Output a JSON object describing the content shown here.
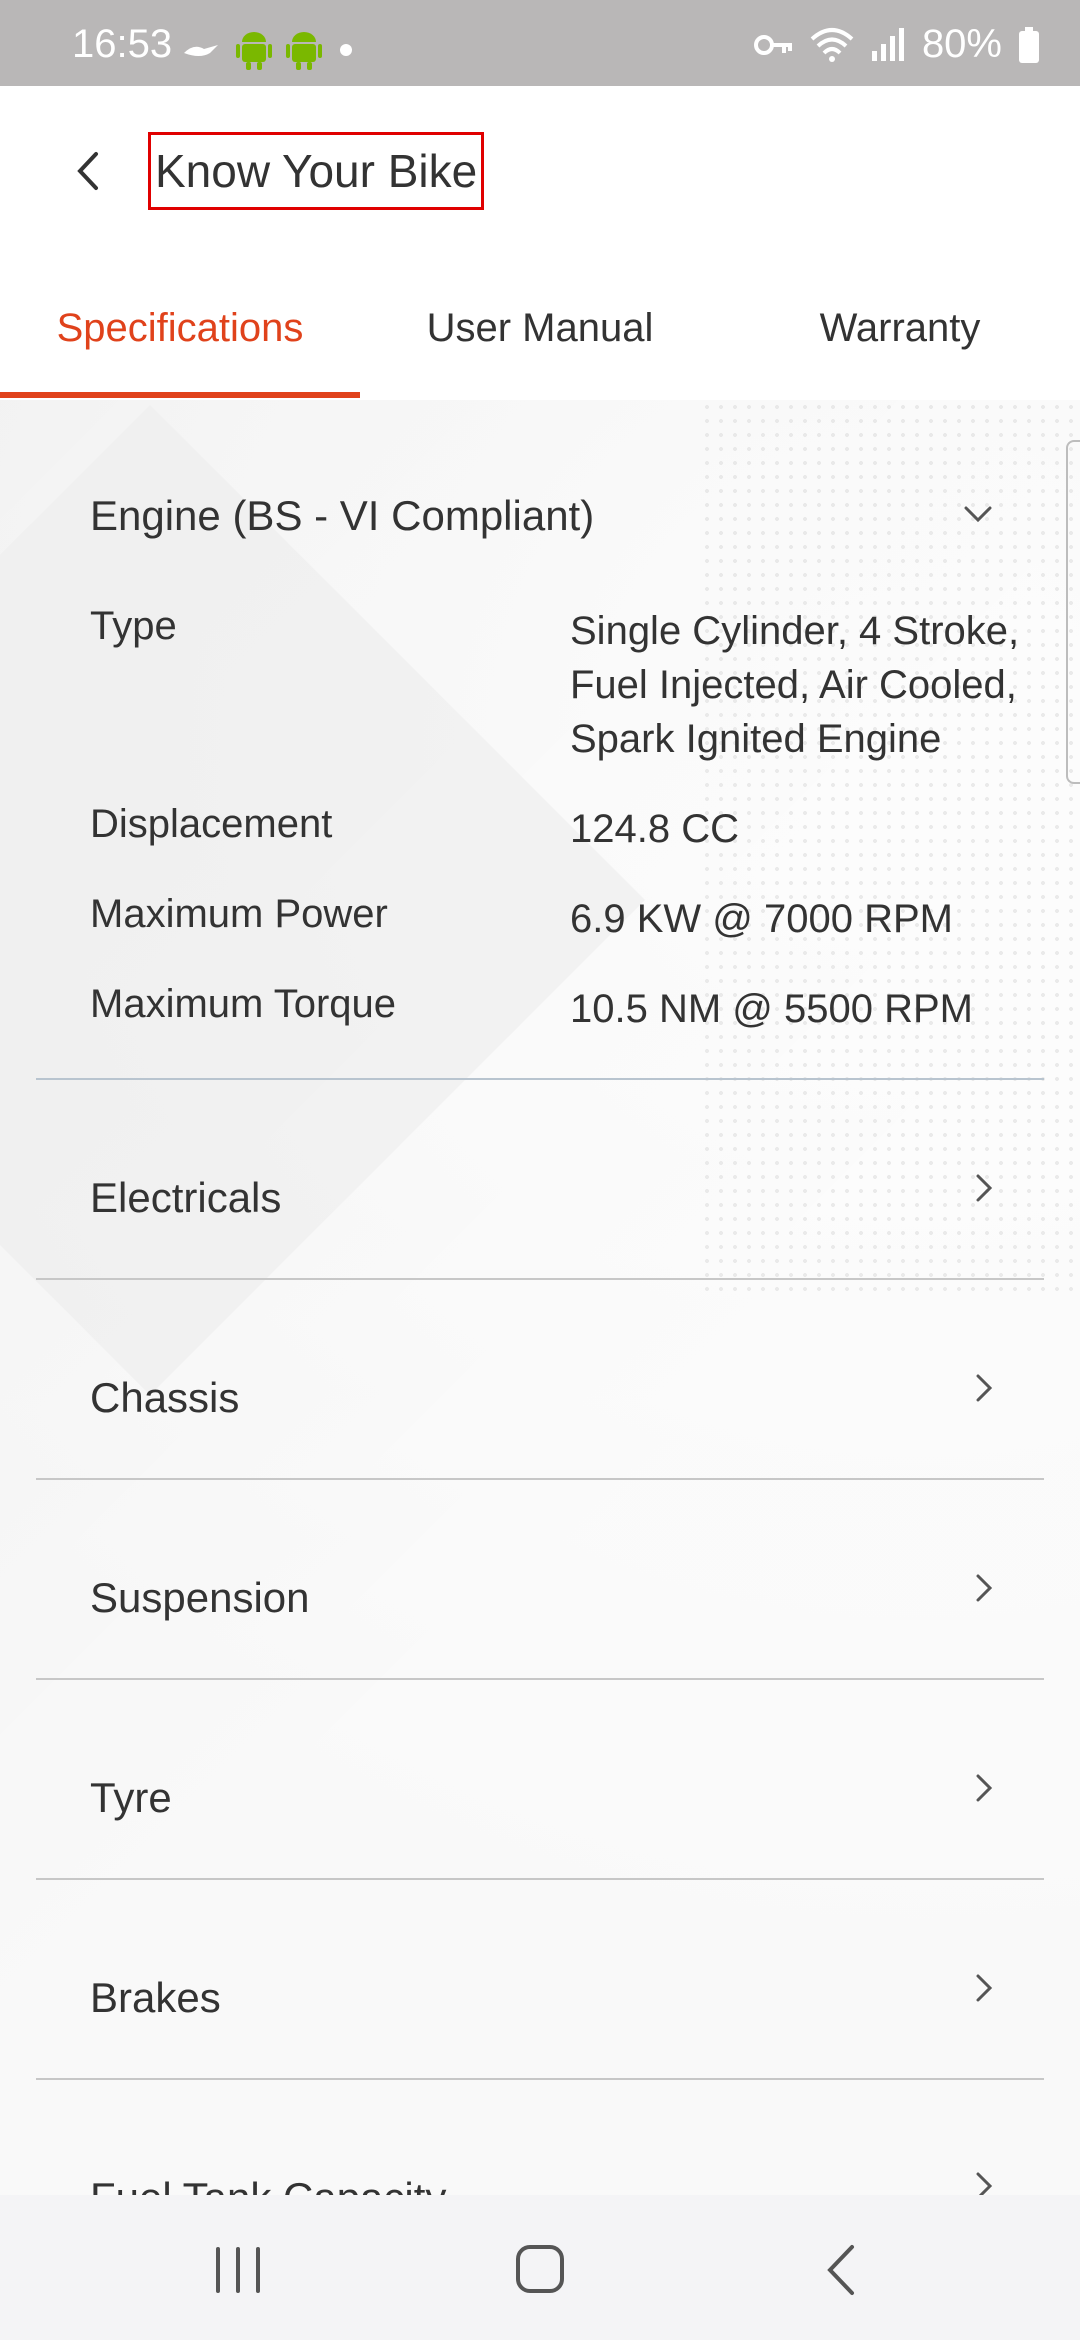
{
  "status_bar": {
    "time": "16:53",
    "battery": "80%",
    "icons": [
      "bird-icon",
      "android-icon",
      "android-icon",
      "dot-icon",
      "key-icon",
      "wifi-icon",
      "signal-icon",
      "battery-icon"
    ]
  },
  "header": {
    "title": "Know Your Bike",
    "back_icon": "chevron-left-icon"
  },
  "tabs": [
    {
      "label": "Specifications",
      "active": true
    },
    {
      "label": "User Manual",
      "active": false
    },
    {
      "label": "Warranty",
      "active": false
    }
  ],
  "engine": {
    "title": "Engine (BS - VI Compliant)",
    "specs": [
      {
        "label": "Type",
        "value_lines": [
          "Single Cylinder, 4 Stroke,",
          "Fuel Injected, Air Cooled,",
          "Spark Ignited Engine"
        ]
      },
      {
        "label": "Displacement",
        "value": "124.8 CC"
      },
      {
        "label": "Maximum Power",
        "value": "6.9 KW @ 7000 RPM"
      },
      {
        "label": "Maximum Torque",
        "value": "10.5 NM @ 5500 RPM"
      }
    ]
  },
  "sections": [
    {
      "title": "Electricals"
    },
    {
      "title": "Chassis"
    },
    {
      "title": "Suspension"
    },
    {
      "title": "Tyre"
    },
    {
      "title": "Brakes"
    },
    {
      "title": "Fuel Tank Capacity"
    }
  ],
  "colors": {
    "accent": "#e0421b",
    "highlight_box": "#e00000",
    "status_bar_bg": "#b9b7b7"
  }
}
